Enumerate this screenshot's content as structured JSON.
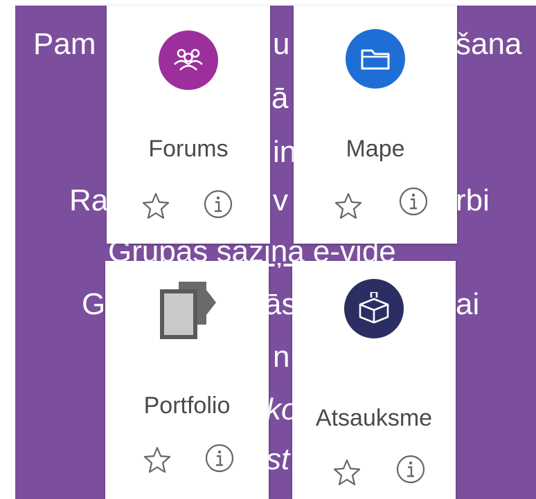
{
  "background_lines": [
    "Pam",
    "u r",
    "šana",
    "ā",
    "in",
    "Ra",
    "v",
    "rbi",
    "Grupas saziņa e-vidē",
    "G",
    "ās",
    "ai",
    "n",
    "ko",
    "st"
  ],
  "cards": [
    {
      "label": "Forums",
      "icon": "users-icon",
      "color": "#9c2f9c"
    },
    {
      "label": "Mape",
      "icon": "folder-icon",
      "color": "#1e6ed6"
    },
    {
      "label": "Portfolio",
      "icon": "portfolio-icon",
      "color": "#5a5a5a"
    },
    {
      "label": "Atsauksme",
      "icon": "feedback-box-icon",
      "color": "#2b2e63"
    }
  ],
  "actions": {
    "star": "star-icon",
    "info": "info-icon"
  }
}
